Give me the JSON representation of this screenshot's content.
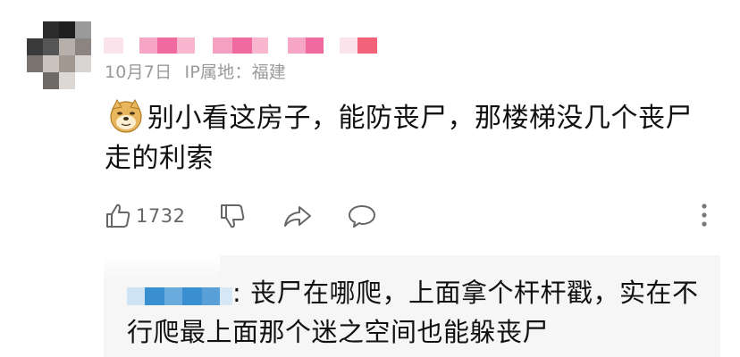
{
  "comment": {
    "date": "10月7日",
    "ip_location": "IP属地：福建",
    "text": "别小看这房子，能防丧尸，那楼梯没几个丧尸走的利索",
    "emoji": "doge-emoji",
    "like_count": "1732"
  },
  "reply": {
    "text": ": 丧尸在哪爬，上面拿个杆杆戳，实在不行爬最上面那个迷之空间也能躲丧尸"
  },
  "icons": {
    "like": "thumbs-up-icon",
    "dislike": "thumbs-down-icon",
    "share": "share-icon",
    "reply": "chat-bubble-icon",
    "more": "more-vertical-icon"
  },
  "colors": {
    "meta": "#9a9a9a",
    "redact_pink": "#f06aa0",
    "redact_blue": "#3a8fd0",
    "reply_bg": "#f6f6f6"
  }
}
